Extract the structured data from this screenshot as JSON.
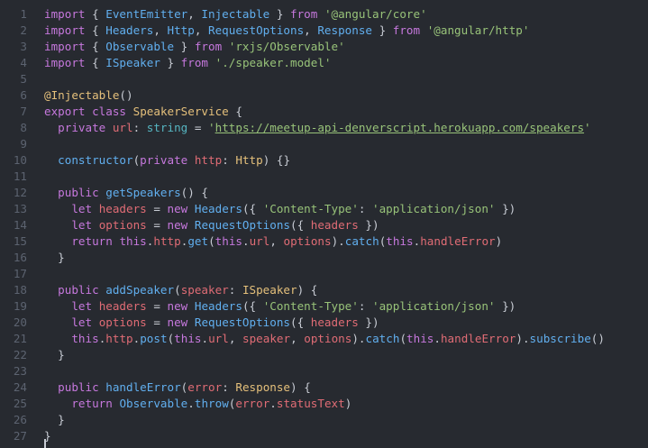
{
  "editor": {
    "line_numbers": [
      "1",
      "2",
      "3",
      "4",
      "5",
      "6",
      "7",
      "8",
      "9",
      "10",
      "11",
      "12",
      "13",
      "14",
      "15",
      "16",
      "17",
      "18",
      "19",
      "20",
      "21",
      "22",
      "23",
      "24",
      "25",
      "26",
      "27"
    ],
    "lines": [
      [
        [
          "kw",
          "import"
        ],
        [
          "pl",
          " { "
        ],
        [
          "fn",
          "EventEmitter"
        ],
        [
          "pl",
          ", "
        ],
        [
          "fn",
          "Injectable"
        ],
        [
          "pl",
          " } "
        ],
        [
          "kw",
          "from"
        ],
        [
          "pl",
          " "
        ],
        [
          "st",
          "'@angular/core'"
        ]
      ],
      [
        [
          "kw",
          "import"
        ],
        [
          "pl",
          " { "
        ],
        [
          "fn",
          "Headers"
        ],
        [
          "pl",
          ", "
        ],
        [
          "fn",
          "Http"
        ],
        [
          "pl",
          ", "
        ],
        [
          "fn",
          "RequestOptions"
        ],
        [
          "pl",
          ", "
        ],
        [
          "fn",
          "Response"
        ],
        [
          "pl",
          " } "
        ],
        [
          "kw",
          "from"
        ],
        [
          "pl",
          " "
        ],
        [
          "st",
          "'@angular/http'"
        ]
      ],
      [
        [
          "kw",
          "import"
        ],
        [
          "pl",
          " { "
        ],
        [
          "fn",
          "Observable"
        ],
        [
          "pl",
          " } "
        ],
        [
          "kw",
          "from"
        ],
        [
          "pl",
          " "
        ],
        [
          "st",
          "'rxjs/Observable'"
        ]
      ],
      [
        [
          "kw",
          "import"
        ],
        [
          "pl",
          " { "
        ],
        [
          "fn",
          "ISpeaker"
        ],
        [
          "pl",
          " } "
        ],
        [
          "kw",
          "from"
        ],
        [
          "pl",
          " "
        ],
        [
          "st",
          "'./speaker.model'"
        ]
      ],
      [],
      [
        [
          "dc",
          "@Injectable"
        ],
        [
          "pl",
          "()"
        ]
      ],
      [
        [
          "kw",
          "export"
        ],
        [
          "pl",
          " "
        ],
        [
          "kw",
          "class"
        ],
        [
          "pl",
          " "
        ],
        [
          "cl",
          "SpeakerService"
        ],
        [
          "pl",
          " {"
        ]
      ],
      [
        [
          "pl",
          "  "
        ],
        [
          "kw",
          "private"
        ],
        [
          "pl",
          " "
        ],
        [
          "pr",
          "url"
        ],
        [
          "pl",
          ": "
        ],
        [
          "ty",
          "string"
        ],
        [
          "pl",
          " = "
        ],
        [
          "st",
          "'"
        ],
        [
          "ur",
          "https://meetup-api-denverscript.herokuapp.com/speakers"
        ],
        [
          "st",
          "'"
        ]
      ],
      [],
      [
        [
          "pl",
          "  "
        ],
        [
          "fn",
          "constructor"
        ],
        [
          "pl",
          "("
        ],
        [
          "kw",
          "private"
        ],
        [
          "pl",
          " "
        ],
        [
          "pr",
          "http"
        ],
        [
          "pl",
          ": "
        ],
        [
          "cl",
          "Http"
        ],
        [
          "pl",
          ") {}"
        ]
      ],
      [],
      [
        [
          "pl",
          "  "
        ],
        [
          "kw",
          "public"
        ],
        [
          "pl",
          " "
        ],
        [
          "fn",
          "getSpeakers"
        ],
        [
          "pl",
          "() {"
        ]
      ],
      [
        [
          "pl",
          "    "
        ],
        [
          "kw",
          "let"
        ],
        [
          "pl",
          " "
        ],
        [
          "pr",
          "headers"
        ],
        [
          "pl",
          " = "
        ],
        [
          "kw",
          "new"
        ],
        [
          "pl",
          " "
        ],
        [
          "fn",
          "Headers"
        ],
        [
          "pl",
          "({ "
        ],
        [
          "st",
          "'Content-Type'"
        ],
        [
          "pl",
          ": "
        ],
        [
          "st",
          "'application/json'"
        ],
        [
          "pl",
          " })"
        ]
      ],
      [
        [
          "pl",
          "    "
        ],
        [
          "kw",
          "let"
        ],
        [
          "pl",
          " "
        ],
        [
          "pr",
          "options"
        ],
        [
          "pl",
          " = "
        ],
        [
          "kw",
          "new"
        ],
        [
          "pl",
          " "
        ],
        [
          "fn",
          "RequestOptions"
        ],
        [
          "pl",
          "({ "
        ],
        [
          "pr",
          "headers"
        ],
        [
          "pl",
          " })"
        ]
      ],
      [
        [
          "pl",
          "    "
        ],
        [
          "kw",
          "return"
        ],
        [
          "pl",
          " "
        ],
        [
          "kw",
          "this"
        ],
        [
          "pl",
          "."
        ],
        [
          "pr",
          "http"
        ],
        [
          "pl",
          "."
        ],
        [
          "fn",
          "get"
        ],
        [
          "pl",
          "("
        ],
        [
          "kw",
          "this"
        ],
        [
          "pl",
          "."
        ],
        [
          "pr",
          "url"
        ],
        [
          "pl",
          ", "
        ],
        [
          "pr",
          "options"
        ],
        [
          "pl",
          ")."
        ],
        [
          "fn",
          "catch"
        ],
        [
          "pl",
          "("
        ],
        [
          "kw",
          "this"
        ],
        [
          "pl",
          "."
        ],
        [
          "pr",
          "handleError"
        ],
        [
          "pl",
          ")"
        ]
      ],
      [
        [
          "pl",
          "  }"
        ]
      ],
      [],
      [
        [
          "pl",
          "  "
        ],
        [
          "kw",
          "public"
        ],
        [
          "pl",
          " "
        ],
        [
          "fn",
          "addSpeaker"
        ],
        [
          "pl",
          "("
        ],
        [
          "pr",
          "speaker"
        ],
        [
          "pl",
          ": "
        ],
        [
          "cl",
          "ISpeaker"
        ],
        [
          "pl",
          ") {"
        ]
      ],
      [
        [
          "pl",
          "    "
        ],
        [
          "kw",
          "let"
        ],
        [
          "pl",
          " "
        ],
        [
          "pr",
          "headers"
        ],
        [
          "pl",
          " = "
        ],
        [
          "kw",
          "new"
        ],
        [
          "pl",
          " "
        ],
        [
          "fn",
          "Headers"
        ],
        [
          "pl",
          "({ "
        ],
        [
          "st",
          "'Content-Type'"
        ],
        [
          "pl",
          ": "
        ],
        [
          "st",
          "'application/json'"
        ],
        [
          "pl",
          " })"
        ]
      ],
      [
        [
          "pl",
          "    "
        ],
        [
          "kw",
          "let"
        ],
        [
          "pl",
          " "
        ],
        [
          "pr",
          "options"
        ],
        [
          "pl",
          " = "
        ],
        [
          "kw",
          "new"
        ],
        [
          "pl",
          " "
        ],
        [
          "fn",
          "RequestOptions"
        ],
        [
          "pl",
          "({ "
        ],
        [
          "pr",
          "headers"
        ],
        [
          "pl",
          " })"
        ]
      ],
      [
        [
          "pl",
          "    "
        ],
        [
          "kw",
          "this"
        ],
        [
          "pl",
          "."
        ],
        [
          "pr",
          "http"
        ],
        [
          "pl",
          "."
        ],
        [
          "fn",
          "post"
        ],
        [
          "pl",
          "("
        ],
        [
          "kw",
          "this"
        ],
        [
          "pl",
          "."
        ],
        [
          "pr",
          "url"
        ],
        [
          "pl",
          ", "
        ],
        [
          "pr",
          "speaker"
        ],
        [
          "pl",
          ", "
        ],
        [
          "pr",
          "options"
        ],
        [
          "pl",
          ")."
        ],
        [
          "fn",
          "catch"
        ],
        [
          "pl",
          "("
        ],
        [
          "kw",
          "this"
        ],
        [
          "pl",
          "."
        ],
        [
          "pr",
          "handleError"
        ],
        [
          "pl",
          ")."
        ],
        [
          "fn",
          "subscribe"
        ],
        [
          "pl",
          "()"
        ]
      ],
      [
        [
          "pl",
          "  }"
        ]
      ],
      [],
      [
        [
          "pl",
          "  "
        ],
        [
          "kw",
          "public"
        ],
        [
          "pl",
          " "
        ],
        [
          "fn",
          "handleError"
        ],
        [
          "pl",
          "("
        ],
        [
          "pr",
          "error"
        ],
        [
          "pl",
          ": "
        ],
        [
          "cl",
          "Response"
        ],
        [
          "pl",
          ") {"
        ]
      ],
      [
        [
          "pl",
          "    "
        ],
        [
          "kw",
          "return"
        ],
        [
          "pl",
          " "
        ],
        [
          "fn",
          "Observable"
        ],
        [
          "pl",
          "."
        ],
        [
          "fn",
          "throw"
        ],
        [
          "pl",
          "("
        ],
        [
          "pr",
          "error"
        ],
        [
          "pl",
          "."
        ],
        [
          "pr",
          "statusText"
        ],
        [
          "pl",
          ")"
        ]
      ],
      [
        [
          "pl",
          "  }"
        ]
      ],
      [
        [
          "pl",
          "}"
        ]
      ]
    ]
  }
}
